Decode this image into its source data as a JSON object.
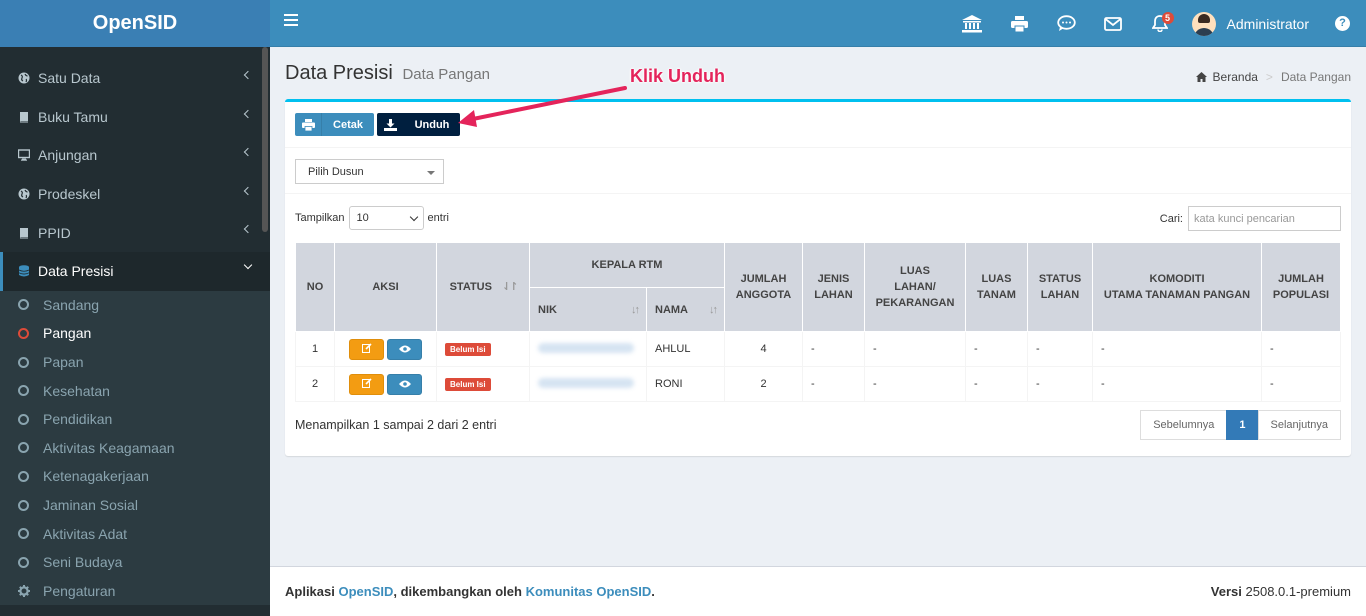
{
  "app": {
    "logo": "OpenSID"
  },
  "header": {
    "user_name": "Administrator",
    "notif_count": "5"
  },
  "sidebar": {
    "items": [
      {
        "label": "Satu Data",
        "icon": "globe-icon"
      },
      {
        "label": "Buku Tamu",
        "icon": "book-icon"
      },
      {
        "label": "Anjungan",
        "icon": "monitor-icon"
      },
      {
        "label": "Prodeskel",
        "icon": "globe-icon"
      },
      {
        "label": "PPID",
        "icon": "book-icon"
      },
      {
        "label": "Data Presisi",
        "icon": "database-icon"
      }
    ],
    "sub_items": [
      "Sandang",
      "Pangan",
      "Papan",
      "Kesehatan",
      "Pendidikan",
      "Aktivitas Keagamaan",
      "Ketenagakerjaan",
      "Jaminan Sosial",
      "Aktivitas Adat",
      "Seni Budaya"
    ],
    "settings_label": "Pengaturan"
  },
  "page": {
    "title": "Data Presisi",
    "subtitle": "Data Pangan",
    "breadcrumb_home": "Beranda",
    "breadcrumb_current": "Data Pangan",
    "callout": "Klik Unduh"
  },
  "toolbar": {
    "cetak_label": "Cetak",
    "unduh_label": "Unduh"
  },
  "filter": {
    "dusun_placeholder": "Pilih Dusun"
  },
  "datatable": {
    "show_label": "Tampilkan",
    "entries_label": "entri",
    "length_value": "10",
    "search_label": "Cari:",
    "search_placeholder": "kata kunci pencarian",
    "info": "Menampilkan 1 sampai 2 dari 2 entri",
    "prev": "Sebelumnya",
    "page": "1",
    "next": "Selanjutnya"
  },
  "table": {
    "headers": {
      "no": "NO",
      "aksi": "AKSI",
      "status": "STATUS",
      "kepala_rtm": "KEPALA RTM",
      "nik": "NIK",
      "nama": "NAMA",
      "jumlah_anggota_1": "JUMLAH",
      "jumlah_anggota_2": "ANGGOTA",
      "jenis_lahan_1": "JENIS",
      "jenis_lahan_2": "LAHAN",
      "luas_lahan_1": "LUAS",
      "luas_lahan_2": "LAHAN/",
      "luas_lahan_3": "PEKARANGAN",
      "luas_tanam_1": "LUAS",
      "luas_tanam_2": "TANAM",
      "status_lahan_1": "STATUS",
      "status_lahan_2": "LAHAN",
      "komoditi_1": "KOMODITI",
      "komoditi_2": "UTAMA TANAMAN PANGAN",
      "jumlah_populasi_1": "JUMLAH",
      "jumlah_populasi_2": "POPULASI"
    },
    "rows": [
      {
        "no": "1",
        "status": "Belum Isi",
        "nama": "AHLUL",
        "jumlah": "4",
        "jenis": "-",
        "luas_lahan": "-",
        "luas_tanam": "-",
        "status_lahan": "-",
        "komoditi": "-",
        "populasi": "-"
      },
      {
        "no": "2",
        "status": "Belum Isi",
        "nama": "RONI",
        "jumlah": "2",
        "jenis": "-",
        "luas_lahan": "-",
        "luas_tanam": "-",
        "status_lahan": "-",
        "komoditi": "-",
        "populasi": "-"
      }
    ]
  },
  "footer": {
    "prefix": "Aplikasi ",
    "app_link": "OpenSID",
    "middle": ", dikembangkan oleh ",
    "community_link": "Komunitas OpenSID",
    "suffix": ".",
    "version_label": "Versi",
    "version": "2508.0.1-premium"
  }
}
